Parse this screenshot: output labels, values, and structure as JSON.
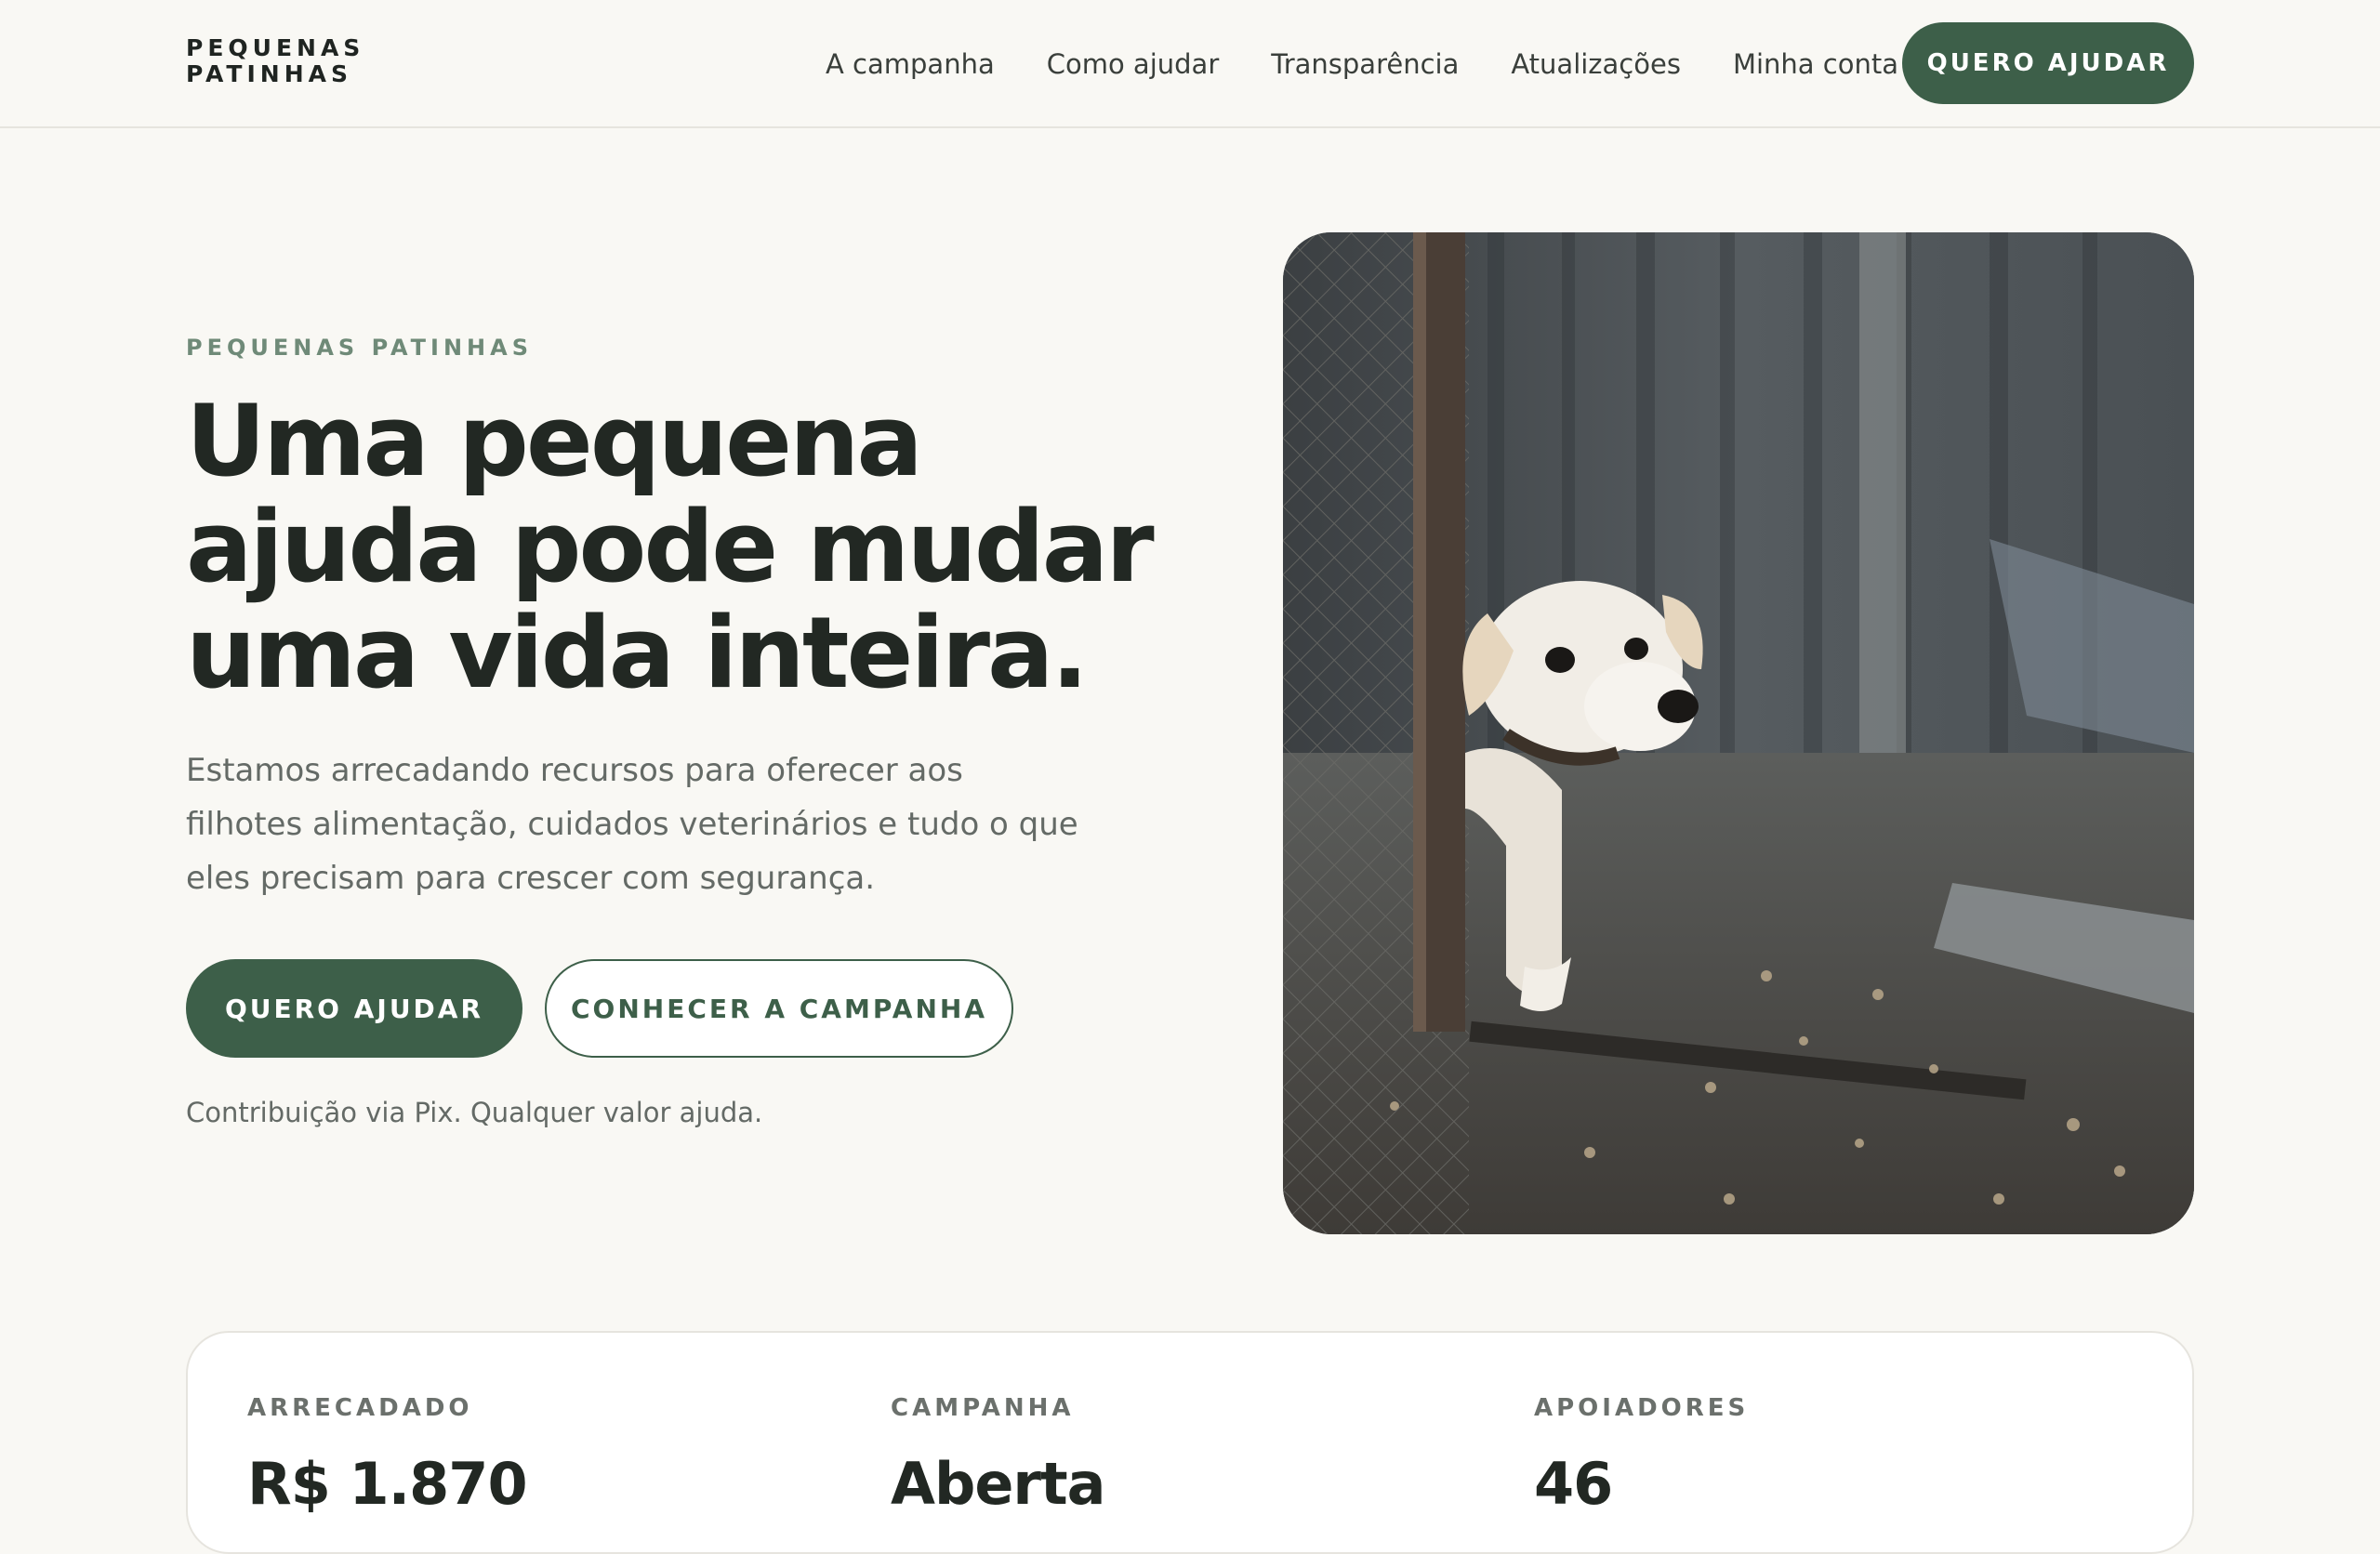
{
  "header": {
    "brand_line1": "PEQUENAS",
    "brand_line2": "PATINHAS",
    "nav": [
      {
        "label": "A campanha"
      },
      {
        "label": "Como ajudar"
      },
      {
        "label": "Transparência"
      },
      {
        "label": "Atualizações"
      },
      {
        "label": "Minha conta"
      }
    ],
    "cta_label": "QUERO AJUDAR"
  },
  "hero": {
    "eyebrow": "PEQUENAS PATINHAS",
    "headline": "Uma pequena ajuda pode mudar uma vida inteira.",
    "lead": "Estamos arrecadando recursos para oferecer aos filhotes alimentação, cuidados veterinários e tudo o que eles precisam para crescer com segurança.",
    "primary_label": "QUERO AJUDAR",
    "secondary_label": "CONHECER A CAMPANHA",
    "note": "Contribuição via Pix. Qualquer valor ajuda."
  },
  "stats": [
    {
      "label": "ARRECADADO",
      "value": "R$ 1.870"
    },
    {
      "label": "CAMPANHA",
      "value": "Aberta"
    },
    {
      "label": "APOIADORES",
      "value": "46"
    }
  ],
  "colors": {
    "background": "#f9f8f4",
    "primary": "#3d5f49",
    "text": "#222823",
    "muted": "#646a66",
    "eyebrow": "#6f8a78"
  }
}
